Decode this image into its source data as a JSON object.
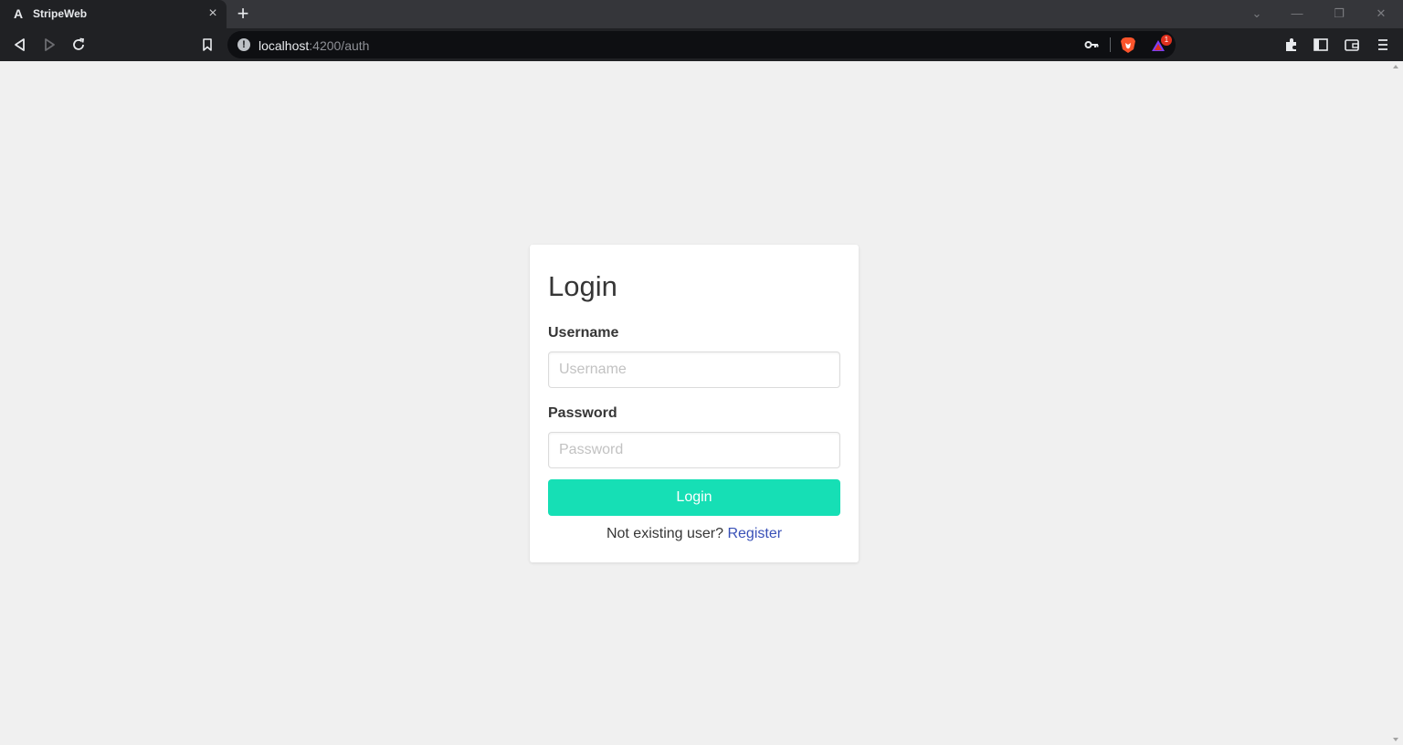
{
  "browser": {
    "tab": {
      "favicon": "A",
      "title": "StripeWeb",
      "close": "×"
    },
    "new_tab": "+",
    "window_controls": {
      "minimize": "—",
      "restore": "❐",
      "close": "✕",
      "tab_search": "⌄"
    },
    "address": {
      "host": "localhost",
      "path": ":4200/auth"
    },
    "rewards_badge": "1",
    "icons": [
      "back-icon",
      "forward-icon",
      "reload-icon",
      "bookmark-icon",
      "site-info-icon",
      "key-icon",
      "brave-shields-icon",
      "brave-rewards-icon",
      "extensions-icon",
      "sidebar-icon",
      "wallet-icon",
      "menu-icon"
    ]
  },
  "login": {
    "title": "Login",
    "username_label": "Username",
    "username_placeholder": "Username",
    "password_label": "Password",
    "password_placeholder": "Password",
    "submit_label": "Login",
    "register_prompt": "Not existing user?",
    "register_link": "Register"
  },
  "colors": {
    "accent": "#16dfb5",
    "link": "#3850b7",
    "page_bg": "#f0f0f0",
    "chrome_bg": "#202124"
  }
}
